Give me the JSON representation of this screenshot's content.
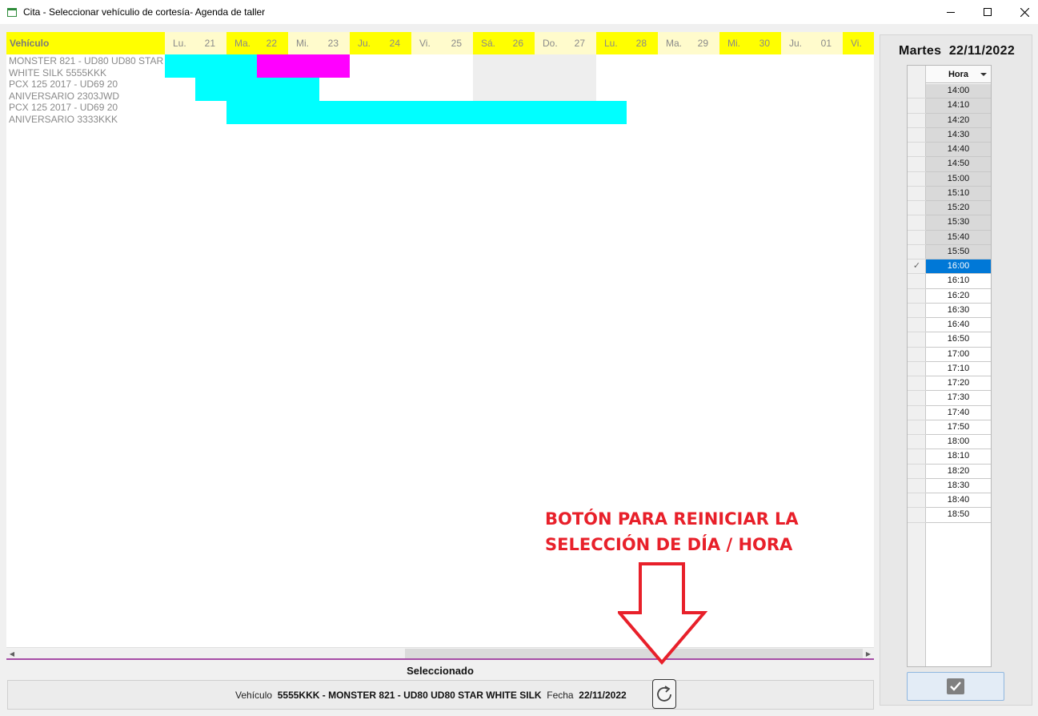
{
  "window": {
    "title": "Cita - Seleccionar vehículio de cortesía- Agenda de taller",
    "controls": [
      "minimize",
      "maximize",
      "close"
    ]
  },
  "gantt": {
    "vehicle_header": "Vehículo",
    "days": [
      {
        "name": "Lu.",
        "num": "21",
        "style": "pale"
      },
      {
        "name": "Ma.",
        "num": "22",
        "style": "yellow"
      },
      {
        "name": "Mi.",
        "num": "23",
        "style": "pale"
      },
      {
        "name": "Ju.",
        "num": "24",
        "style": "yellow"
      },
      {
        "name": "Vi.",
        "num": "25",
        "style": "pale"
      },
      {
        "name": "Sá.",
        "num": "26",
        "style": "yellow"
      },
      {
        "name": "Do.",
        "num": "27",
        "style": "pale"
      },
      {
        "name": "Lu.",
        "num": "28",
        "style": "yellow"
      },
      {
        "name": "Ma.",
        "num": "29",
        "style": "pale"
      },
      {
        "name": "Mi.",
        "num": "30",
        "style": "yellow"
      },
      {
        "name": "Ju.",
        "num": "01",
        "style": "pale"
      },
      {
        "name": "Vi.",
        "num": "",
        "style": "yellow"
      }
    ],
    "vehicles": [
      "MONSTER 821 - UD80 UD80 STAR",
      "WHITE SILK 5555KKK",
      "PCX 125 2017 - UD69 20",
      "ANIVERSARIO 2303JWD",
      "PCX 125 2017 - UD69 20",
      "ANIVERSARIO 3333KKK"
    ],
    "colors": {
      "cyan": "#00ffff",
      "magenta": "#ff00ff",
      "yellow": "#ffff00",
      "pale_yellow": "#fffbcc"
    }
  },
  "selection": {
    "label": "Seleccionado",
    "vehicle_label": "Vehículo",
    "vehicle_value": "5555KKK - MONSTER 821 - UD80 UD80 STAR WHITE SILK",
    "date_label": "Fecha",
    "date_value": "22/11/2022",
    "reset_icon": "refresh-icon"
  },
  "agenda": {
    "date_title": "Martes  22/11/2022",
    "column_header": "Hora",
    "selected_time": "16:00",
    "times": [
      {
        "t": "14:00",
        "state": "gray"
      },
      {
        "t": "14:10",
        "state": "gray"
      },
      {
        "t": "14:20",
        "state": "gray"
      },
      {
        "t": "14:30",
        "state": "gray"
      },
      {
        "t": "14:40",
        "state": "gray"
      },
      {
        "t": "14:50",
        "state": "gray"
      },
      {
        "t": "15:00",
        "state": "gray"
      },
      {
        "t": "15:10",
        "state": "gray"
      },
      {
        "t": "15:20",
        "state": "gray"
      },
      {
        "t": "15:30",
        "state": "gray"
      },
      {
        "t": "15:40",
        "state": "gray"
      },
      {
        "t": "15:50",
        "state": "gray"
      },
      {
        "t": "16:00",
        "state": "selected"
      },
      {
        "t": "16:10",
        "state": "free"
      },
      {
        "t": "16:20",
        "state": "free"
      },
      {
        "t": "16:30",
        "state": "free"
      },
      {
        "t": "16:40",
        "state": "free"
      },
      {
        "t": "16:50",
        "state": "free"
      },
      {
        "t": "17:00",
        "state": "free"
      },
      {
        "t": "17:10",
        "state": "free"
      },
      {
        "t": "17:20",
        "state": "free"
      },
      {
        "t": "17:30",
        "state": "free"
      },
      {
        "t": "17:40",
        "state": "free"
      },
      {
        "t": "17:50",
        "state": "free"
      },
      {
        "t": "18:00",
        "state": "free"
      },
      {
        "t": "18:10",
        "state": "free"
      },
      {
        "t": "18:20",
        "state": "free"
      },
      {
        "t": "18:30",
        "state": "free"
      },
      {
        "t": "18:40",
        "state": "free"
      },
      {
        "t": "18:50",
        "state": "free"
      }
    ],
    "confirm_icon": "checkmark-icon"
  },
  "annotation": {
    "line1": "BOTÓN PARA REINICIAR LA",
    "line2": "SELECCIÓN DE DÍA / HORA",
    "color": "#e8202a"
  }
}
